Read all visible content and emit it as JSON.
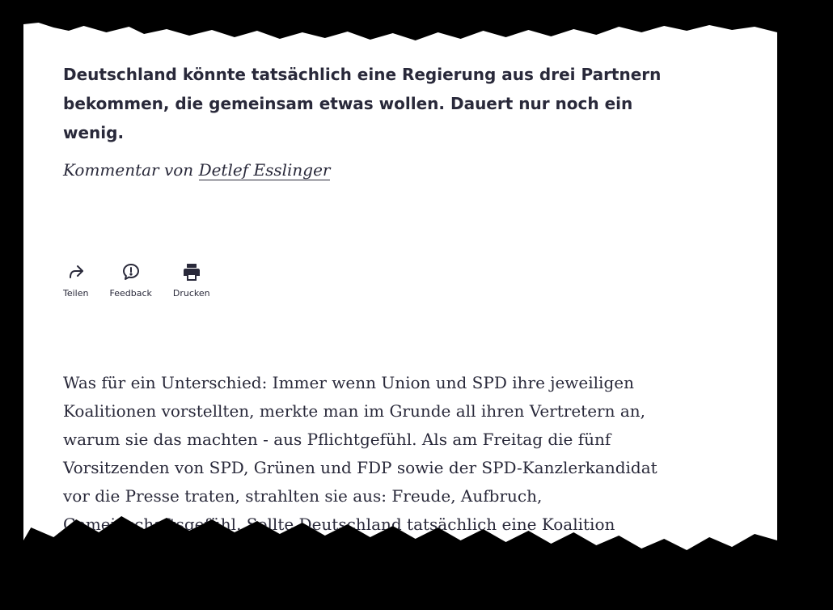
{
  "article": {
    "teaser": "Deutschland könnte tatsächlich eine Regierung aus drei Partnern bekommen, die gemeinsam etwas wollen. Dauert nur noch ein wenig.",
    "byline_prefix": "Kommentar von ",
    "author": "Detlef Esslinger"
  },
  "actions": [
    {
      "label": "Teilen",
      "icon": "share-icon"
    },
    {
      "label": "Feedback",
      "icon": "feedback-icon"
    },
    {
      "label": "Drucken",
      "icon": "print-icon"
    }
  ],
  "body_lines": [
    "Was für ein Unterschied: Immer wenn Union und SPD ihre jeweiligen",
    "Koalitionen vorstellten, merkte man im Grunde all ihren Vertretern an,",
    "warum sie das machten - aus Pflichtgefühl. Als am Freitag die fünf",
    "Vorsitzenden von SPD, Grünen und FDP sowie der SPD-Kanzlerkandidat",
    "vor die Presse traten, strahlten sie aus: Freude, Aufbruch,",
    "Gemeinschaftsgefühl. Sollte Deutschland tatsächlich eine Koalition"
  ]
}
